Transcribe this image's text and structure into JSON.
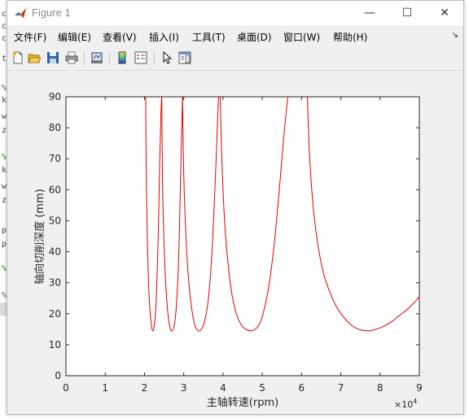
{
  "background_code": {
    "lines": [
      "c",
      "c",
      "c",
      "t",
      "%",
      "k",
      "w",
      "z",
      "%",
      "k",
      "w",
      "z",
      "p",
      "p",
      "%",
      "%"
    ]
  },
  "window": {
    "title": "Figure 1",
    "icon": "matlab-icon",
    "controls": {
      "minimize": "—",
      "maximize": "☐",
      "close": "✕"
    }
  },
  "menu": {
    "items": [
      "文件(F)",
      "编辑(E)",
      "查看(V)",
      "插入(I)",
      "工具(T)",
      "桌面(D)",
      "窗口(W)",
      "帮助(H)"
    ],
    "dock_arrow": "↘"
  },
  "toolbar": {
    "icons": [
      "new-figure-icon",
      "open-file-icon",
      "save-icon",
      "print-icon",
      "link-plot-icon",
      "colorbar-icon",
      "legend-icon",
      "pointer-icon",
      "property-editor-icon"
    ]
  },
  "chart_data": {
    "type": "line",
    "title": "",
    "xlabel": "主轴转速(rpm)",
    "ylabel": "轴向切削深度 (mm)",
    "x_exponent_label": "×10",
    "x_exponent_power": "4",
    "xlim": [
      0,
      90000
    ],
    "ylim": [
      0,
      90
    ],
    "x_tick_labels": [
      "0",
      "1",
      "2",
      "3",
      "4",
      "5",
      "6",
      "7",
      "8",
      "9"
    ],
    "y_tick_labels": [
      "0",
      "10",
      "20",
      "30",
      "40",
      "50",
      "60",
      "70",
      "80",
      "90"
    ],
    "line_color": "#e00000",
    "grid": false,
    "lobes": [
      {
        "x": [
          20300,
          20500,
          20800,
          21100,
          21400,
          21800,
          22100,
          22400,
          22800,
          23100,
          23500,
          23900,
          24200,
          24400
        ],
        "y": [
          90,
          60,
          40,
          28,
          21,
          16,
          14.5,
          15.5,
          20,
          28,
          45,
          70,
          85,
          90
        ]
      },
      {
        "x": [
          24400,
          24600,
          25000,
          25400,
          25900,
          26400,
          26800,
          27300,
          27800,
          28300,
          28800,
          29300,
          29700
        ],
        "y": [
          90,
          62,
          42,
          30,
          21,
          16,
          14.5,
          15,
          18,
          26,
          42,
          70,
          90
        ]
      },
      {
        "x": [
          29700,
          30000,
          30600,
          31300,
          32100,
          32900,
          33700,
          34500,
          35400,
          36300,
          37200,
          38000,
          38600,
          38900
        ],
        "y": [
          90,
          65,
          44,
          30,
          21,
          16,
          14.5,
          15,
          18,
          25,
          40,
          62,
          82,
          90
        ]
      },
      {
        "x": [
          39300,
          39700,
          40400,
          41300,
          42300,
          43400,
          44600,
          45800,
          47000,
          48200,
          49400,
          50600,
          51800,
          53000,
          54200,
          55400,
          56500
        ],
        "y": [
          90,
          70,
          50,
          36,
          26,
          20,
          16.5,
          15,
          14.5,
          15,
          17,
          22,
          30,
          42,
          58,
          76,
          90
        ]
      },
      {
        "x": [
          61500,
          62000,
          63000,
          64200,
          65600,
          67200,
          69000,
          71000,
          73000,
          75000,
          77000,
          79000,
          81000,
          83000,
          85000,
          87000,
          89000,
          90000
        ],
        "y": [
          90,
          72,
          54,
          42,
          33,
          27,
          22,
          18.5,
          16,
          14.8,
          14.5,
          15,
          16,
          17.5,
          19.5,
          21.5,
          24,
          25.5
        ]
      }
    ]
  }
}
